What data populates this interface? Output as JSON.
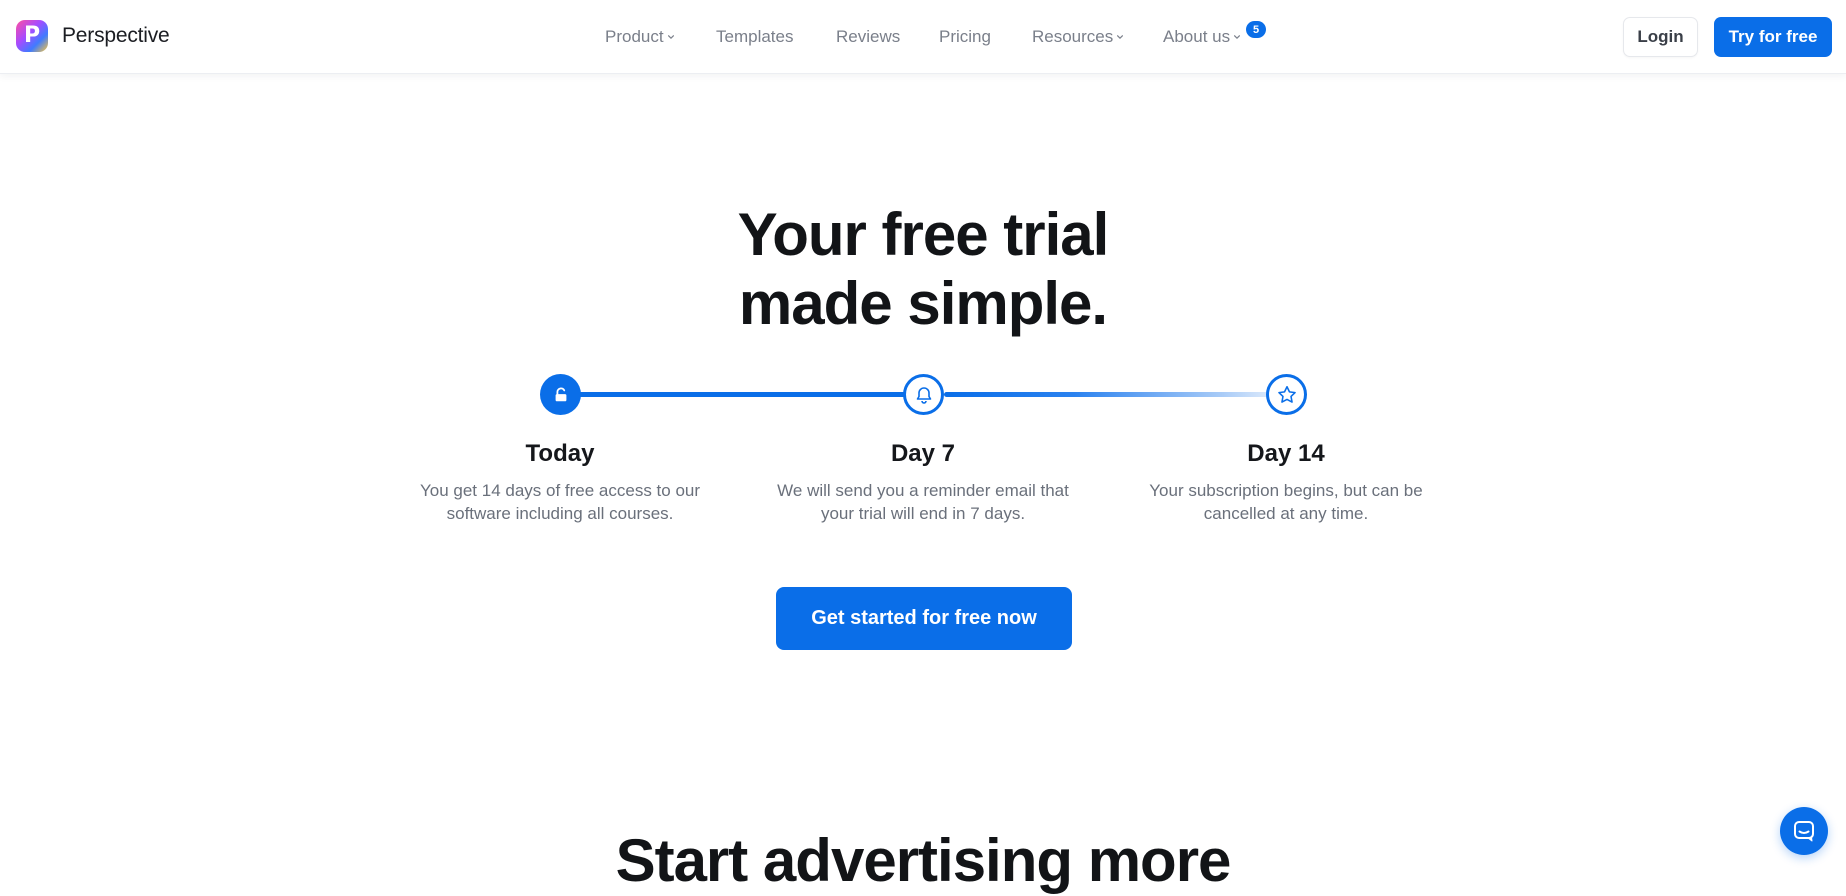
{
  "brand": {
    "logo_letter": "P",
    "name": "Perspective"
  },
  "nav": {
    "items": [
      {
        "label": "Product",
        "has_dropdown": true
      },
      {
        "label": "Templates",
        "has_dropdown": false
      },
      {
        "label": "Reviews",
        "has_dropdown": false
      },
      {
        "label": "Pricing",
        "has_dropdown": false
      },
      {
        "label": "Resources",
        "has_dropdown": true
      },
      {
        "label": "About us",
        "has_dropdown": true
      }
    ],
    "about_badge": "5",
    "login_label": "Login",
    "try_label": "Try for free"
  },
  "hero": {
    "title_line1": "Your free trial",
    "title_line2": "made simple.",
    "steps": [
      {
        "icon": "unlock-icon",
        "title": "Today",
        "desc": "You get 14 days of free access to our software including all courses."
      },
      {
        "icon": "bell-icon",
        "title": "Day 7",
        "desc": "We will send you a reminder email that your trial will end in 7 days."
      },
      {
        "icon": "star-icon",
        "title": "Day 14",
        "desc": "Your subscription begins, but can be cancelled at any time."
      }
    ],
    "cta_label": "Get started for free now"
  },
  "next_section": {
    "title": "Start advertising more"
  },
  "colors": {
    "accent": "#0a6ee8",
    "nav_text": "#7a7f8a",
    "body_text": "#6a707b",
    "heading": "#121417"
  }
}
